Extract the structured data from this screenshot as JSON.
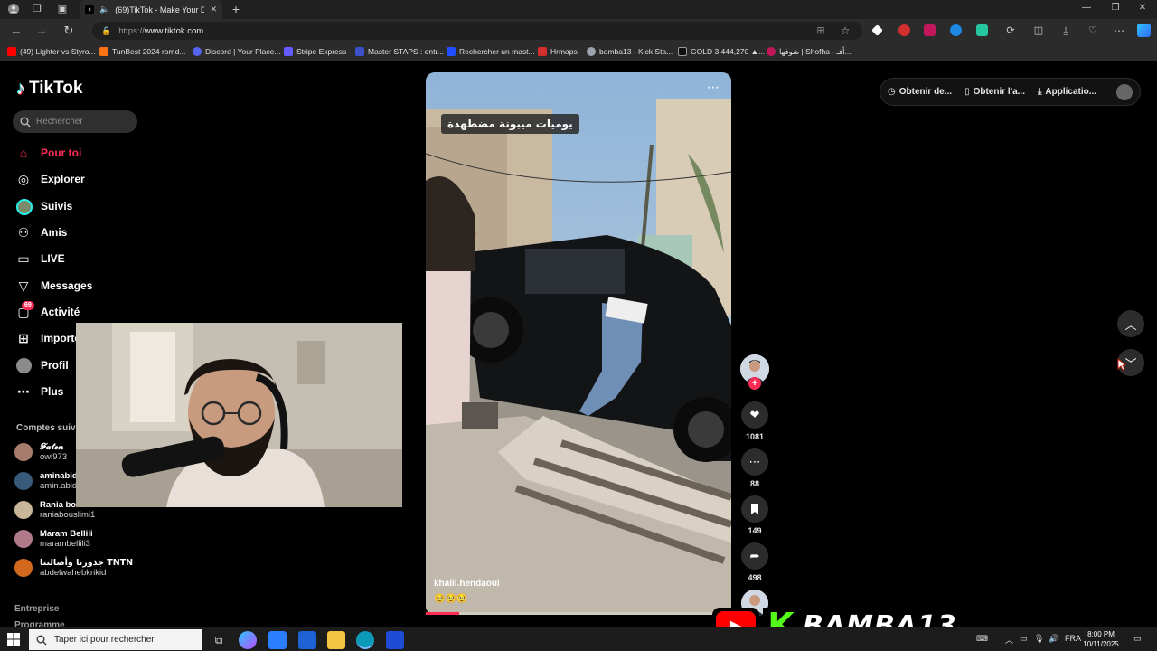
{
  "browser": {
    "tab_title": "(69)TikTok - Make Your Day",
    "url_protocol": "https://",
    "url_host": "www.tiktok.com",
    "bookmarks": [
      {
        "label": "(49) Lighter vs Styro...",
        "color": "#ff0000"
      },
      {
        "label": "TunBest 2024 romd...",
        "color": "#f97316"
      },
      {
        "label": "Discord | Your Place...",
        "color": "#5865f2"
      },
      {
        "label": "Stripe Express",
        "color": "#635bff"
      },
      {
        "label": "Master STAPS : entr...",
        "color": "#3b4fc8"
      },
      {
        "label": "Rechercher un mast...",
        "color": "#1f4fff"
      },
      {
        "label": "Hrmaps",
        "color": "#d32f2f"
      },
      {
        "label": "bamba13 - Kick Sta...",
        "color": "#9ca3af"
      },
      {
        "label": "GOLD 3 444,270 ▲...",
        "color": "#111111"
      },
      {
        "label": "شوفها | Shofha - أفـ...",
        "color": "#c2185b"
      }
    ]
  },
  "tiktok": {
    "brand": "TikTok",
    "search_placeholder": "Rechercher",
    "nav": [
      {
        "label": "Pour toi",
        "icon": "home-icon"
      },
      {
        "label": "Explorer",
        "icon": "compass-icon"
      },
      {
        "label": "Suivis",
        "icon": "following-avatar-icon"
      },
      {
        "label": "Amis",
        "icon": "friends-icon"
      },
      {
        "label": "LIVE",
        "icon": "live-icon"
      },
      {
        "label": "Messages",
        "icon": "messages-icon"
      },
      {
        "label": "Activité",
        "icon": "activity-icon",
        "badge": "69"
      },
      {
        "label": "Importer",
        "icon": "upload-icon"
      },
      {
        "label": "Profil",
        "icon": "profile-icon"
      },
      {
        "label": "Plus",
        "icon": "more-icon"
      }
    ],
    "following_title": "Comptes suivis",
    "following": [
      {
        "name": "𝓕𝓪𝓽𝓮𝓷",
        "handle": "owl973",
        "color": "#a67c6d"
      },
      {
        "name": "aminabid",
        "handle": "amin.abid",
        "color": "#3a5a7a"
      },
      {
        "name": "Rania bo...",
        "handle": "raniabouslimi1",
        "color": "#c8b59a"
      },
      {
        "name": "Maram Bellili",
        "handle": "marambellili3",
        "color": "#b07a8a"
      },
      {
        "name": "جذورنا وأصالتنا TNTN",
        "handle": "abdelwahebkrikid",
        "color": "#d2691e"
      }
    ],
    "footer_links": [
      "Entreprise",
      "Programme"
    ],
    "top_actions": [
      {
        "label": "Obtenir de...",
        "icon": "coin-icon"
      },
      {
        "label": "Obtenir l'a...",
        "icon": "phone-icon"
      },
      {
        "label": "Applicatio...",
        "icon": "download-icon"
      }
    ],
    "video": {
      "caption": "يوميات ميبونة مضطهدة",
      "author": "khalil.hendaoui",
      "emojis": "🥹🥹🥹",
      "progress": 0.11
    },
    "actions": {
      "likes": "1081",
      "comments": "88",
      "saves": "149",
      "shares": "498"
    }
  },
  "overlay": {
    "streamer": "BAMBA13"
  },
  "taskbar": {
    "search_placeholder": "Taper ici pour rechercher",
    "lang": "FRA",
    "time": "8:00 PM",
    "date": "10/11/2025"
  }
}
